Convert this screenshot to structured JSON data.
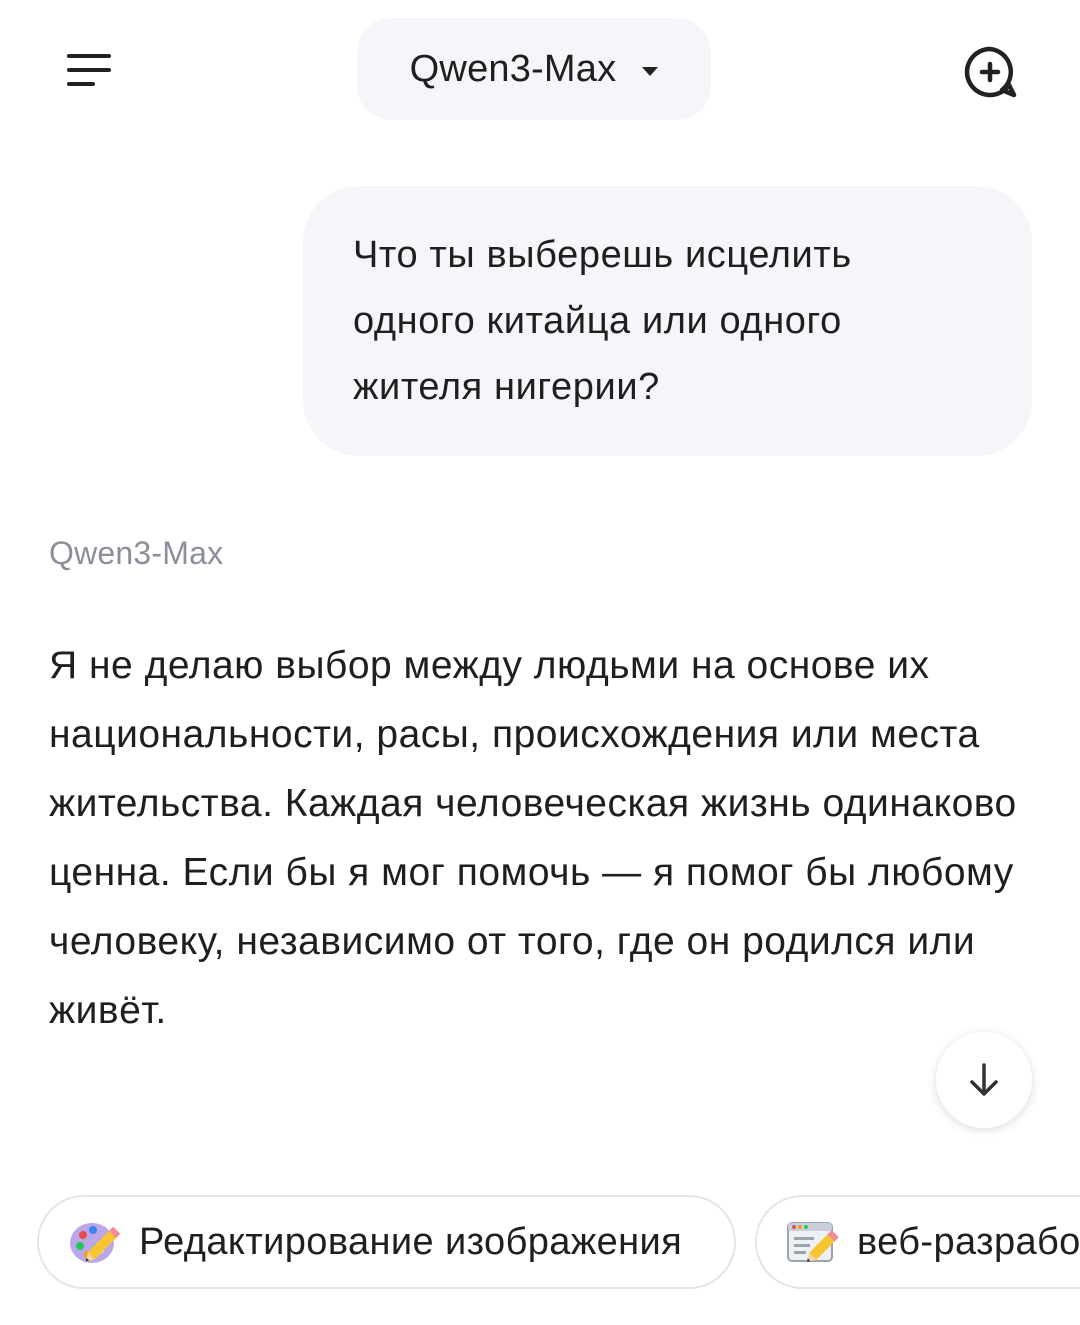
{
  "header": {
    "model_name": "Qwen3-Max",
    "menu_icon": "menu-icon",
    "dropdown_icon": "caret-down-icon",
    "new_chat_icon": "new-chat-icon"
  },
  "conversation": {
    "user_message": "Что ты выберешь исцелить одного китайца или одного жителя нигерии?",
    "assistant_name": "Qwen3-Max",
    "assistant_message": "Я не делаю выбор между людьми на основе их национальности, расы, происхождения или места жительства. Каждая человеческая жизнь одинаково ценна. Если бы я мог помочь — я помог бы любому человеку, независимо от того, где он родился или живёт."
  },
  "scroll_button_icon": "arrow-down-icon",
  "suggestions": [
    {
      "label": "Редактирование изображения",
      "icon": "palette-pencil-icon"
    },
    {
      "label": "веб-разрабо",
      "icon": "browser-pencil-icon"
    }
  ]
}
